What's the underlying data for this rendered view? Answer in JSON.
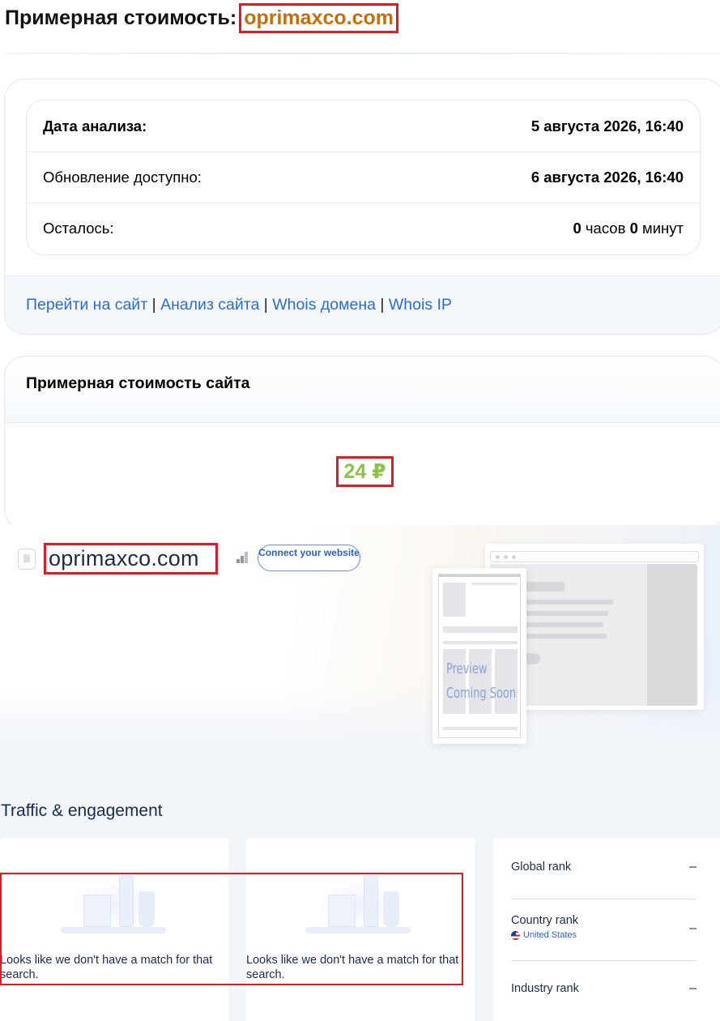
{
  "header": {
    "title_prefix": "Примерная стоимость:",
    "domain": "oprimaxco.com"
  },
  "analysis": {
    "rows": [
      {
        "label": "Дата анализа:",
        "value": "5 августа 2026, 16:40"
      },
      {
        "label": "Обновление доступно:",
        "value": "6 августа 2026, 16:40"
      },
      {
        "label": "Осталось:",
        "hours": "0",
        "hours_unit": "часов",
        "minutes": "0",
        "minutes_unit": "минут"
      }
    ],
    "links": [
      {
        "label": "Перейти на сайт"
      },
      {
        "label": "Анализ сайта"
      },
      {
        "label": "Whois домена"
      },
      {
        "label": "Whois IP"
      }
    ],
    "separator": "|"
  },
  "valuation": {
    "title": "Примерная стоимость сайта",
    "value": "24 ₽"
  },
  "similarweb": {
    "domain": "oprimaxco.com",
    "connect_button": "Connect your website",
    "preview_text_1": "Preview",
    "preview_text_2": "Coming Soon",
    "section_title": "Traffic & engagement",
    "empty_message": "Looks like we don't have a match for that search.",
    "ranks": [
      {
        "label": "Global rank",
        "value": "–"
      },
      {
        "label": "Country rank",
        "value": "–",
        "country": "United States"
      },
      {
        "label": "Industry rank",
        "value": "–"
      }
    ],
    "colors": {
      "highlight_border": "#e01b24",
      "domain_orange": "#c2700c",
      "value_green": "#8bc34a",
      "link_blue": "#2f6bd8"
    }
  }
}
